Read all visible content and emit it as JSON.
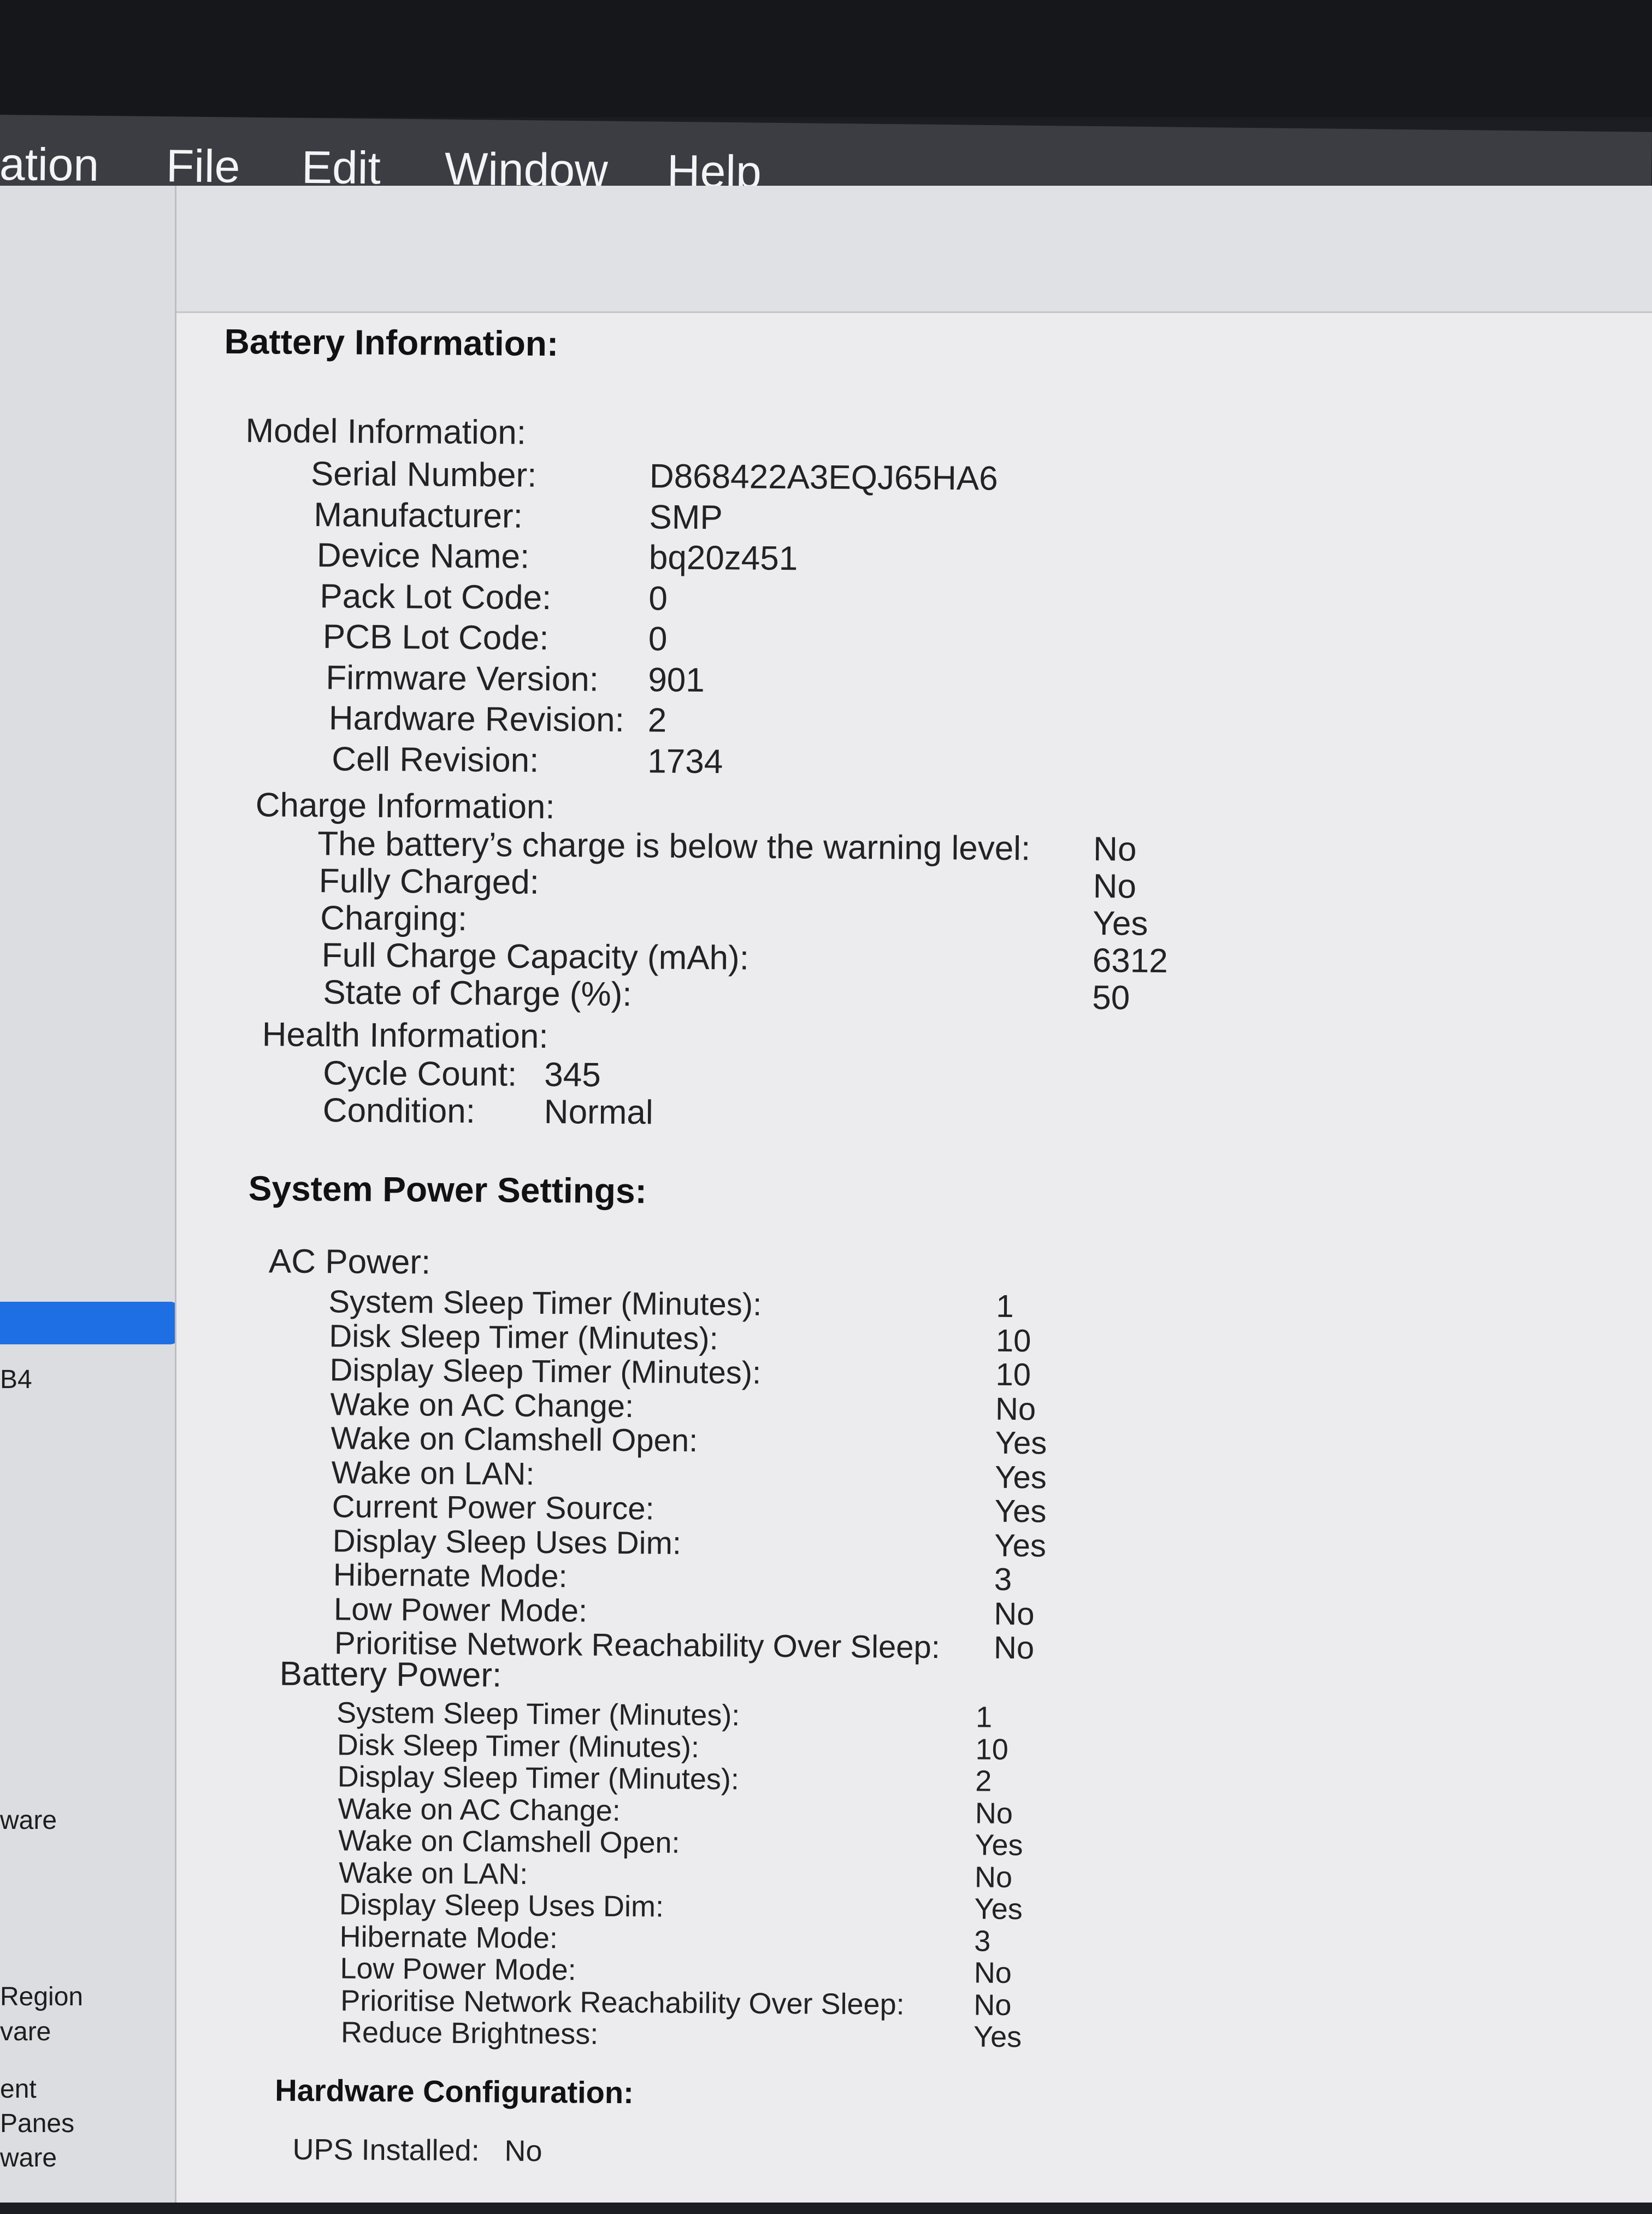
{
  "menubar": {
    "items": [
      "ation",
      "File",
      "Edit",
      "Window",
      "Help"
    ]
  },
  "sidebar": {
    "items": [
      "B4",
      "ware",
      "Region",
      "vare",
      "ent",
      "Panes",
      "ware"
    ]
  },
  "report": {
    "battery_heading": "Battery Information:",
    "model": {
      "title": "Model Information:",
      "rows": [
        {
          "label": "Serial Number:",
          "value": "D868422A3EQJ65HA6"
        },
        {
          "label": "Manufacturer:",
          "value": "SMP"
        },
        {
          "label": "Device Name:",
          "value": "bq20z451"
        },
        {
          "label": "Pack Lot Code:",
          "value": "0"
        },
        {
          "label": "PCB Lot Code:",
          "value": "0"
        },
        {
          "label": "Firmware Version:",
          "value": "901"
        },
        {
          "label": "Hardware Revision:",
          "value": "2"
        },
        {
          "label": "Cell Revision:",
          "value": "1734"
        }
      ]
    },
    "charge": {
      "title": "Charge Information:",
      "rows": [
        {
          "label": "The battery’s charge is below the warning level:",
          "value": "No"
        },
        {
          "label": "Fully Charged:",
          "value": "No"
        },
        {
          "label": "Charging:",
          "value": "Yes"
        },
        {
          "label": "Full Charge Capacity (mAh):",
          "value": "6312"
        },
        {
          "label": "State of Charge (%):",
          "value": "50"
        }
      ]
    },
    "health": {
      "title": "Health Information:",
      "rows": [
        {
          "label": "Cycle Count:",
          "value": "345"
        },
        {
          "label": "Condition:",
          "value": "Normal"
        }
      ]
    },
    "power_heading": "System Power Settings:",
    "ac": {
      "title": "AC Power:",
      "rows": [
        {
          "label": "System Sleep Timer (Minutes):",
          "value": "1"
        },
        {
          "label": "Disk Sleep Timer (Minutes):",
          "value": "10"
        },
        {
          "label": "Display Sleep Timer (Minutes):",
          "value": "10"
        },
        {
          "label": "Wake on AC Change:",
          "value": "No"
        },
        {
          "label": "Wake on Clamshell Open:",
          "value": "Yes"
        },
        {
          "label": "Wake on LAN:",
          "value": "Yes"
        },
        {
          "label": "Current Power Source:",
          "value": "Yes"
        },
        {
          "label": "Display Sleep Uses Dim:",
          "value": "Yes"
        },
        {
          "label": "Hibernate Mode:",
          "value": "3"
        },
        {
          "label": "Low Power Mode:",
          "value": "No"
        },
        {
          "label": "Prioritise Network Reachability Over Sleep:",
          "value": "No"
        }
      ]
    },
    "battery_power": {
      "title": "Battery Power:",
      "rows": [
        {
          "label": "System Sleep Timer (Minutes):",
          "value": "1"
        },
        {
          "label": "Disk Sleep Timer (Minutes):",
          "value": "10"
        },
        {
          "label": "Display Sleep Timer (Minutes):",
          "value": "2"
        },
        {
          "label": "Wake on AC Change:",
          "value": "No"
        },
        {
          "label": "Wake on Clamshell Open:",
          "value": "Yes"
        },
        {
          "label": "Wake on LAN:",
          "value": "No"
        },
        {
          "label": "Display Sleep Uses Dim:",
          "value": "Yes"
        },
        {
          "label": "Hibernate Mode:",
          "value": "3"
        },
        {
          "label": "Low Power Mode:",
          "value": "No"
        },
        {
          "label": "Prioritise Network Reachability Over Sleep:",
          "value": "No"
        },
        {
          "label": "Reduce Brightness:",
          "value": "Yes"
        }
      ]
    },
    "hardware_heading": "Hardware Configuration:",
    "ups": {
      "label": "UPS Installed:",
      "value": "No"
    }
  },
  "colors": {
    "menubar": "#3c3d42",
    "selection": "#1f6fe4",
    "content_bg": "#ececee"
  }
}
